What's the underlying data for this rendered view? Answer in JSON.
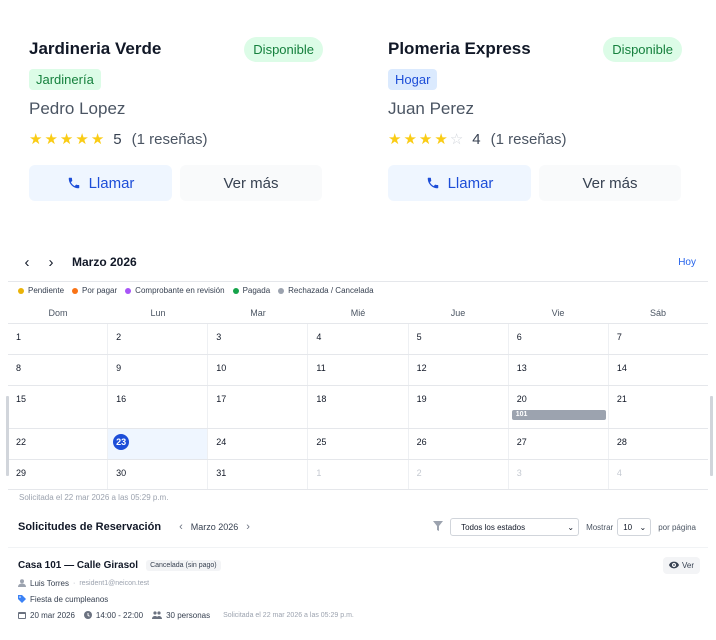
{
  "providers": [
    {
      "title": "Jardineria Verde",
      "status": "Disponible",
      "category": "Jardinería",
      "person": "Pedro Lopez",
      "rating": 5,
      "rating_label": "5",
      "reviews": "(1 reseñas)",
      "call_label": "Llamar",
      "more_label": "Ver más"
    },
    {
      "title": "Plomeria Express",
      "status": "Disponible",
      "category": "Hogar",
      "person": "Juan Perez",
      "rating": 4,
      "rating_label": "4",
      "reviews": "(1 reseñas)",
      "call_label": "Llamar",
      "more_label": "Ver más"
    }
  ],
  "calendar": {
    "month_label": "Marzo 2026",
    "today_label": "Hoy",
    "legend": [
      {
        "label": "Pendiente",
        "color": "#eab308"
      },
      {
        "label": "Por pagar",
        "color": "#f97316"
      },
      {
        "label": "Comprobante en revisión",
        "color": "#a855f7"
      },
      {
        "label": "Pagada",
        "color": "#16a34a"
      },
      {
        "label": "Rechazada / Cancelada",
        "color": "#9ca3af"
      }
    ],
    "weekdays": [
      "Dom",
      "Lun",
      "Mar",
      "Mié",
      "Jue",
      "Vie",
      "Sáb"
    ],
    "weeks": [
      [
        "1",
        "2",
        "3",
        "4",
        "5",
        "6",
        "7"
      ],
      [
        "8",
        "9",
        "10",
        "11",
        "12",
        "13",
        "14"
      ],
      [
        "15",
        "16",
        "17",
        "18",
        "19",
        "20",
        "21"
      ],
      [
        "22",
        "23",
        "24",
        "25",
        "26",
        "27",
        "28"
      ],
      [
        "29",
        "30",
        "31",
        "1",
        "2",
        "3",
        "4"
      ]
    ],
    "today": "23",
    "event": {
      "day": "20",
      "label": "101",
      "color": "#9ca3af"
    },
    "footnote": "Solicitada el 22 mar 2026 a las 05:29 p.m."
  },
  "reservations": {
    "title": "Solicitudes de Reservación",
    "month_label": "Marzo 2026",
    "status_filter": "Todos los estados",
    "show_label": "Mostrar",
    "page_size": "10",
    "per_page_label": "por página",
    "items": [
      {
        "name": "Casa 101 — Calle Girasol",
        "tag": "Cancelada (sin pago)",
        "user": "Luis Torres",
        "email": "resident1@neicon.test",
        "event": "Fiesta de cumpleanos",
        "date": "20 mar 2026",
        "time": "14:00 - 22:00",
        "people": "30 personas",
        "requested": "Solicitada el 22 mar 2026 a las 05:29 p.m.",
        "view_label": "Ver"
      }
    ]
  },
  "colors": {
    "accent": "#1d4ed8",
    "available_bg": "#dcfce7",
    "available_text": "#15803d",
    "star": "#facc15"
  }
}
